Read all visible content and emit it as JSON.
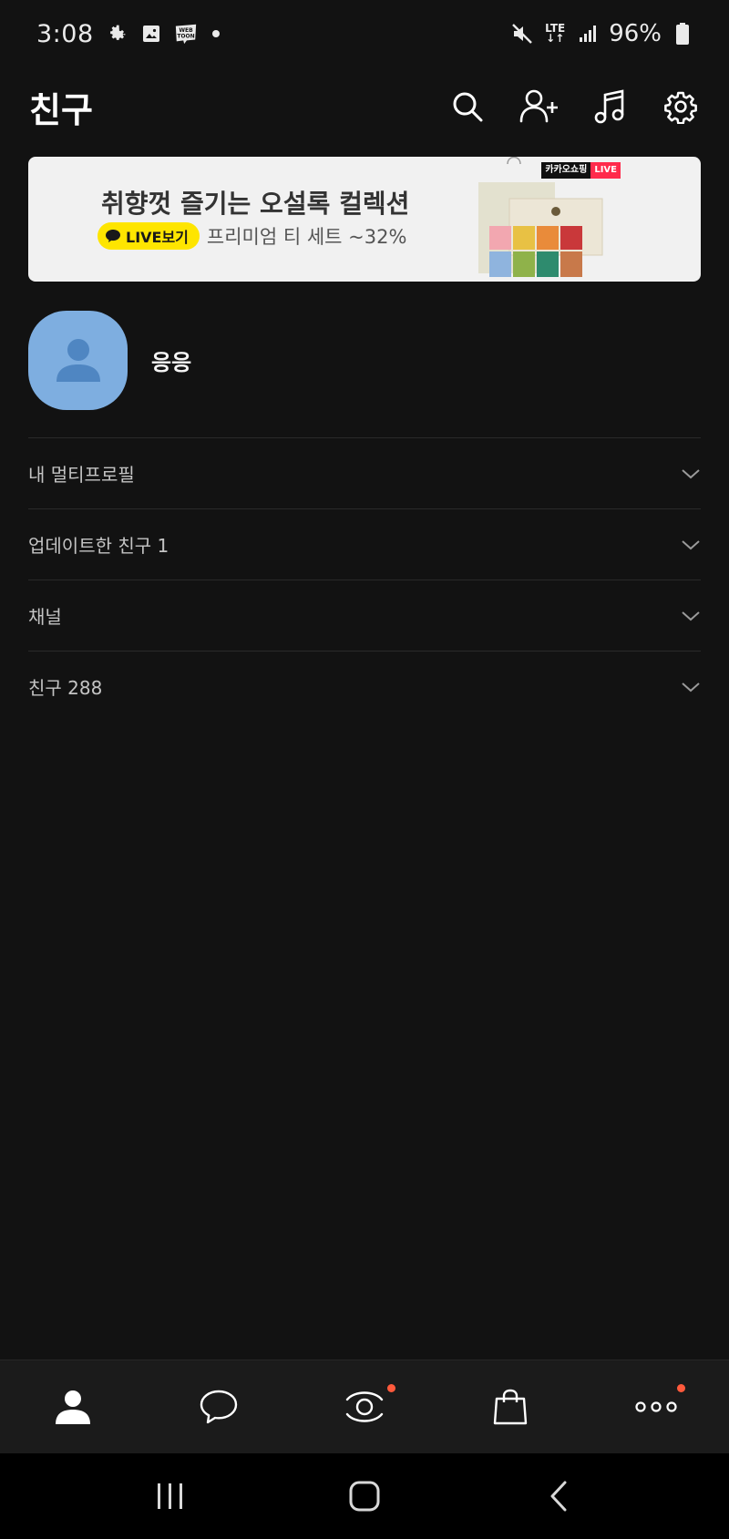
{
  "status_bar": {
    "time": "3:08",
    "network": "LTE",
    "battery": "96%",
    "icons": [
      "gear-icon",
      "gallery-icon",
      "webtoon-icon",
      "notification-dot",
      "mute-icon",
      "lte-icon",
      "signal-icon",
      "battery-icon"
    ],
    "webtoon_text": "WEB TOON"
  },
  "header": {
    "title": "친구",
    "actions": [
      "search-icon",
      "add-friend-icon",
      "music-icon",
      "settings-icon"
    ]
  },
  "banner": {
    "title": "취향껏 즐기는 오설록 컬렉션",
    "live_button": "LIVE보기",
    "description": "프리미엄 티 세트 ~32%",
    "tag_brand": "카카오쇼핑",
    "tag_live": "LIVE"
  },
  "profile": {
    "name": "응응"
  },
  "sections": [
    {
      "label": "내 멀티프로필"
    },
    {
      "label": "업데이트한 친구 1"
    },
    {
      "label": "채널"
    },
    {
      "label": "친구 288"
    }
  ],
  "tab_bar": {
    "tabs": [
      "friends-tab",
      "chats-tab",
      "view-tab",
      "shopping-tab",
      "more-tab"
    ]
  },
  "colors": {
    "background": "#121212",
    "accent_yellow": "#fee500",
    "avatar": "#7eaee0",
    "badge": "#ff5a3c",
    "live_red": "#ff2a4b"
  }
}
